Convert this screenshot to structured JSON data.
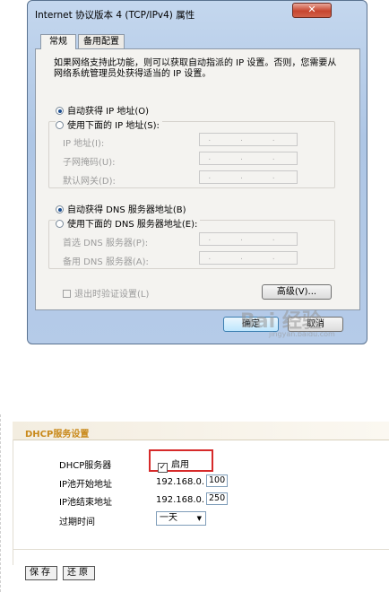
{
  "dialog": {
    "title": "Internet 协议版本 4 (TCP/IPv4) 属性",
    "close_label": "✕",
    "tabs": [
      {
        "label": "常规"
      },
      {
        "label": "备用配置"
      }
    ],
    "description": "如果网络支持此功能，则可以获取自动指派的 IP 设置。否则，您需要从网络系统管理员处获得适当的 IP 设置。",
    "ip_auto": {
      "label": "自动获得 IP 地址(O)",
      "selected": true
    },
    "ip_manual": {
      "label": "使用下面的 IP 地址(S):",
      "selected": false
    },
    "ip_fields": [
      {
        "label": "IP 地址(I):",
        "value": ". . ."
      },
      {
        "label": "子网掩码(U):",
        "value": ". . ."
      },
      {
        "label": "默认网关(D):",
        "value": ". . ."
      }
    ],
    "dns_auto": {
      "label": "自动获得 DNS 服务器地址(B)",
      "selected": true
    },
    "dns_manual": {
      "label": "使用下面的 DNS 服务器地址(E):",
      "selected": false
    },
    "dns_fields": [
      {
        "label": "首选 DNS 服务器(P):",
        "value": ". . ."
      },
      {
        "label": "备用 DNS 服务器(A):",
        "value": ". . ."
      }
    ],
    "validate_on_exit": {
      "label": "退出时验证设置(L)",
      "checked": false
    },
    "advanced_label": "高级(V)...",
    "ok_label": "确定",
    "cancel_label": "取消",
    "watermark": "Bai 经验",
    "watermark_sub": "jingyan.baidu.com"
  },
  "router": {
    "section_title": "DHCP服务设置",
    "dhcp_server": {
      "label": "DHCP服务器",
      "checkbox_label": "启用",
      "checked": true,
      "check_mark": "✓"
    },
    "pool_start": {
      "label": "IP池开始地址",
      "prefix": "192.168.0.",
      "value": "100"
    },
    "pool_end": {
      "label": "IP池结束地址",
      "prefix": "192.168.0.",
      "value": "250"
    },
    "lease_time": {
      "label": "过期时间",
      "selected": "一天",
      "arrow": "▼"
    },
    "save_label": "保存",
    "reset_label": "还原"
  },
  "colors": {
    "accent_title": "#c98a1c",
    "highlight_border": "#d62a2a",
    "close_button": "#c7462f"
  }
}
